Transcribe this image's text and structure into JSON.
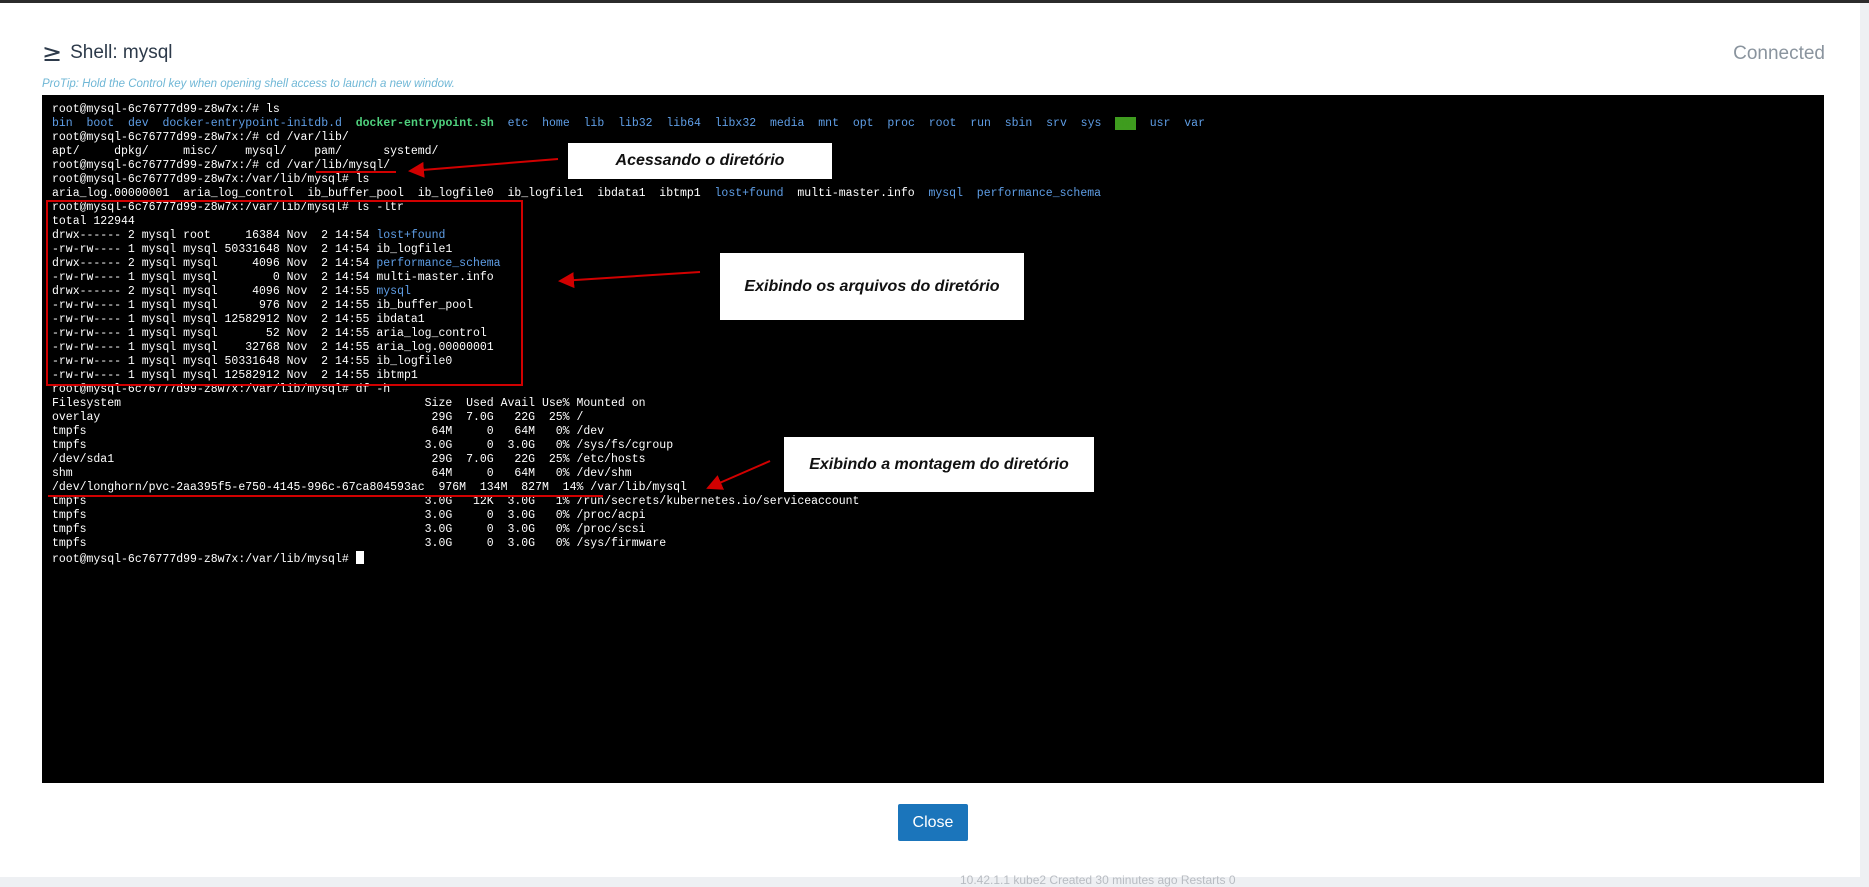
{
  "window": {
    "title": "Shell: mysql",
    "status": "Connected",
    "protip": "ProTip: Hold the Control key when opening shell access to launch a new window."
  },
  "icons": {
    "shell": "shell-prompt-icon"
  },
  "background_text": "10.42.1.1   kube2   Created 30 minutes ago   Restarts 0",
  "terminal": {
    "lines": [
      [
        {
          "t": "root@mysql-6c76777d99-z8w7x:/# ls"
        }
      ],
      [
        {
          "t": "bin",
          "c": "dir"
        },
        {
          "t": "  "
        },
        {
          "t": "boot",
          "c": "dir"
        },
        {
          "t": "  "
        },
        {
          "t": "dev",
          "c": "dir"
        },
        {
          "t": "  "
        },
        {
          "t": "docker-entrypoint-initdb.d",
          "c": "dir"
        },
        {
          "t": "  "
        },
        {
          "t": "docker-entrypoint.sh",
          "c": "exec"
        },
        {
          "t": "  "
        },
        {
          "t": "etc",
          "c": "dir"
        },
        {
          "t": "  "
        },
        {
          "t": "home",
          "c": "dir"
        },
        {
          "t": "  "
        },
        {
          "t": "lib",
          "c": "dir"
        },
        {
          "t": "  "
        },
        {
          "t": "lib32",
          "c": "dir"
        },
        {
          "t": "  "
        },
        {
          "t": "lib64",
          "c": "dir"
        },
        {
          "t": "  "
        },
        {
          "t": "libx32",
          "c": "dir"
        },
        {
          "t": "  "
        },
        {
          "t": "media",
          "c": "dir"
        },
        {
          "t": "  "
        },
        {
          "t": "mnt",
          "c": "dir"
        },
        {
          "t": "  "
        },
        {
          "t": "opt",
          "c": "dir"
        },
        {
          "t": "  "
        },
        {
          "t": "proc",
          "c": "dir"
        },
        {
          "t": "  "
        },
        {
          "t": "root",
          "c": "dir"
        },
        {
          "t": "  "
        },
        {
          "t": "run",
          "c": "dir"
        },
        {
          "t": "  "
        },
        {
          "t": "sbin",
          "c": "dir"
        },
        {
          "t": "  "
        },
        {
          "t": "srv",
          "c": "dir"
        },
        {
          "t": "  "
        },
        {
          "t": "sys",
          "c": "dir"
        },
        {
          "t": "  "
        },
        {
          "t": "tmp",
          "c": "hl"
        },
        {
          "t": "  "
        },
        {
          "t": "usr",
          "c": "dir"
        },
        {
          "t": "  "
        },
        {
          "t": "var",
          "c": "dir"
        }
      ],
      [
        {
          "t": "root@mysql-6c76777d99-z8w7x:/# cd /var/lib/"
        }
      ],
      [
        {
          "t": "apt/     dpkg/     misc/    mysql/    pam/      systemd/"
        }
      ],
      [
        {
          "t": "root@mysql-6c76777d99-z8w7x:/# cd /var/lib/mysql/"
        }
      ],
      [
        {
          "t": "root@mysql-6c76777d99-z8w7x:/var/lib/mysql# ls"
        }
      ],
      [
        {
          "t": "aria_log.00000001  aria_log_control  ib_buffer_pool  ib_logfile0  ib_logfile1  ibdata1  ibtmp1  "
        },
        {
          "t": "lost+found",
          "c": "dir"
        },
        {
          "t": "  multi-master.info  "
        },
        {
          "t": "mysql",
          "c": "dir"
        },
        {
          "t": "  "
        },
        {
          "t": "performance_schema",
          "c": "dir"
        }
      ],
      [
        {
          "t": "root@mysql-6c76777d99-z8w7x:/var/lib/mysql# ls -ltr"
        }
      ],
      [
        {
          "t": "total 122944"
        }
      ],
      [
        {
          "t": "drwx------ 2 mysql root     16384 Nov  2 14:54 "
        },
        {
          "t": "lost+found",
          "c": "dir"
        }
      ],
      [
        {
          "t": "-rw-rw---- 1 mysql mysql 50331648 Nov  2 14:54 ib_logfile1"
        }
      ],
      [
        {
          "t": "drwx------ 2 mysql mysql     4096 Nov  2 14:54 "
        },
        {
          "t": "performance_schema",
          "c": "dir"
        }
      ],
      [
        {
          "t": "-rw-rw---- 1 mysql mysql        0 Nov  2 14:54 multi-master.info"
        }
      ],
      [
        {
          "t": "drwx------ 2 mysql mysql     4096 Nov  2 14:55 "
        },
        {
          "t": "mysql",
          "c": "dir"
        }
      ],
      [
        {
          "t": "-rw-rw---- 1 mysql mysql      976 Nov  2 14:55 ib_buffer_pool"
        }
      ],
      [
        {
          "t": "-rw-rw---- 1 mysql mysql 12582912 Nov  2 14:55 ibdata1"
        }
      ],
      [
        {
          "t": "-rw-rw---- 1 mysql mysql       52 Nov  2 14:55 aria_log_control"
        }
      ],
      [
        {
          "t": "-rw-rw---- 1 mysql mysql    32768 Nov  2 14:55 aria_log.00000001"
        }
      ],
      [
        {
          "t": "-rw-rw---- 1 mysql mysql 50331648 Nov  2 14:55 ib_logfile0"
        }
      ],
      [
        {
          "t": "-rw-rw---- 1 mysql mysql 12582912 Nov  2 14:55 ibtmp1"
        }
      ],
      [
        {
          "t": "root@mysql-6c76777d99-z8w7x:/var/lib/mysql# df -h"
        }
      ],
      [
        {
          "t": "Filesystem                                            Size  Used Avail Use% Mounted on"
        }
      ],
      [
        {
          "t": "overlay                                                29G  7.0G   22G  25% /"
        }
      ],
      [
        {
          "t": "tmpfs                                                  64M     0   64M   0% /dev"
        }
      ],
      [
        {
          "t": "tmpfs                                                 3.0G     0  3.0G   0% /sys/fs/cgroup"
        }
      ],
      [
        {
          "t": "/dev/sda1                                              29G  7.0G   22G  25% /etc/hosts"
        }
      ],
      [
        {
          "t": "shm                                                    64M     0   64M   0% /dev/shm"
        }
      ],
      [
        {
          "t": "/dev/longhorn/pvc-2aa395f5-e750-4145-996c-67ca804593ac  976M  134M  827M  14% /var/lib/mysql"
        }
      ],
      [
        {
          "t": "tmpfs                                                 3.0G   12K  3.0G   1% /run/secrets/kubernetes.io/serviceaccount"
        }
      ],
      [
        {
          "t": "tmpfs                                                 3.0G     0  3.0G   0% /proc/acpi"
        }
      ],
      [
        {
          "t": "tmpfs                                                 3.0G     0  3.0G   0% /proc/scsi"
        }
      ],
      [
        {
          "t": "tmpfs                                                 3.0G     0  3.0G   0% /sys/firmware"
        }
      ],
      [
        {
          "t": "root@mysql-6c76777d99-z8w7x:/var/lib/mysql# "
        },
        {
          "t": "",
          "c": "cursor"
        }
      ]
    ]
  },
  "annotations": {
    "callout_1": "Acessando o diretório",
    "callout_2": "Exibindo os arquivos do diretório",
    "callout_3": "Exibindo a montagem do diretório",
    "accent_color": "#d10000"
  },
  "footer": {
    "close_label": "Close",
    "button_color": "#1b75bb"
  }
}
